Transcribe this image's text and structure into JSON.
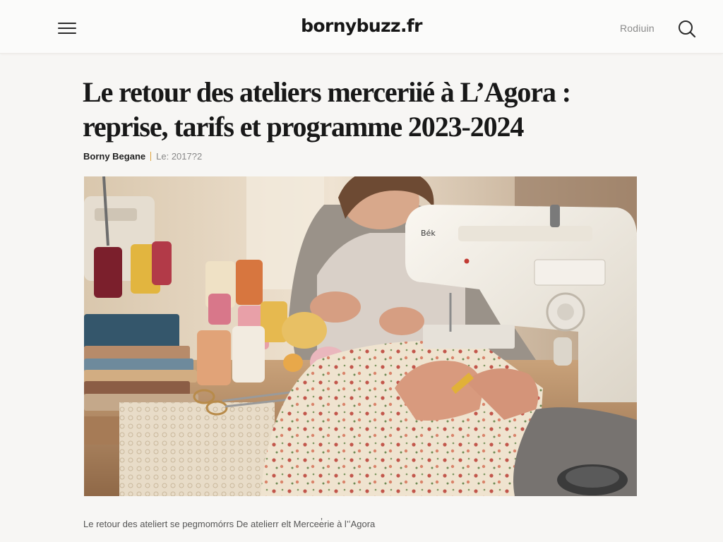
{
  "header": {
    "logo": "bornybuzz.fr",
    "login_label": "Rodiuin",
    "menu_icon": "hamburger-menu-icon",
    "search_icon": "search-icon"
  },
  "article": {
    "title_line1": "Le retour des ateliers merceriié à L’Agora :",
    "title_line2": "reprise, tarifs et programme 2023-2024",
    "author": "Borny Begane",
    "date": "Le: 2017?2",
    "image_caption": "Le retour des ateliert se pegmomórrs De atelierr elt Mercee̓rie à l’ʻAgora",
    "image_label": "Bék"
  },
  "colors": {
    "accent": "#e0a33a",
    "background": "#f7f6f4",
    "text": "#1d1d1d"
  }
}
